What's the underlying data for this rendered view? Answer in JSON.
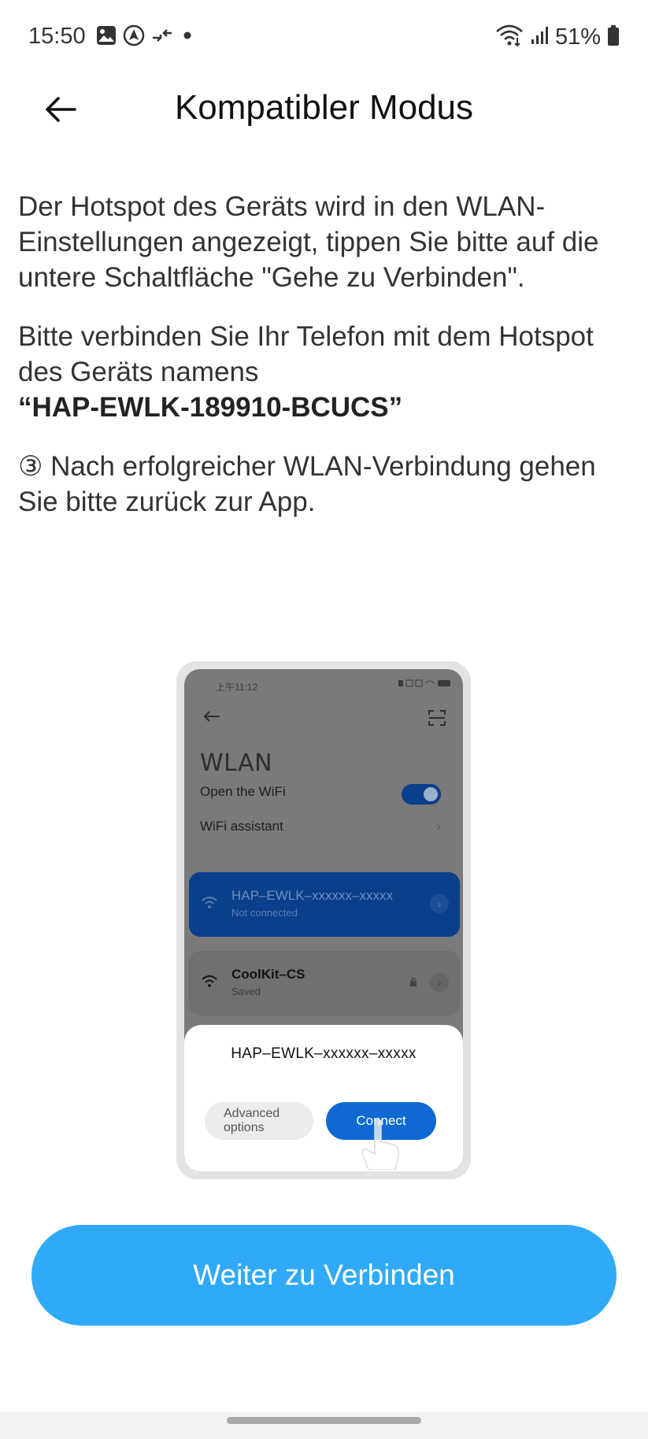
{
  "status_bar": {
    "time": "15:50",
    "battery": "51%",
    "icons": [
      "image-icon",
      "location-icon",
      "transfer-icon",
      "dot-icon",
      "wifi-icon",
      "signal-icon",
      "battery-icon"
    ]
  },
  "header": {
    "title": "Kompatibler Modus",
    "back_icon": "arrow-left-icon"
  },
  "instructions": {
    "paragraph1": "Der Hotspot des Geräts wird in den WLAN-Einstellungen angezeigt, tippen Sie bitte auf die untere Schaltfläche \"Gehe zu Verbinden\".",
    "paragraph2_text": "Bitte verbinden Sie Ihr Telefon mit dem Hotspot des Geräts namens",
    "hotspot_name": "“HAP-EWLK-189910-BCUCS”",
    "paragraph3": "③ Nach erfolgreicher WLAN-Verbindung gehen Sie bitte zurück zur App."
  },
  "illustration": {
    "time": "上午11:12",
    "title": "WLAN",
    "open_wifi_label": "Open the WiFi",
    "wifi_assistant_label": "WiFi assistant",
    "networks": [
      {
        "name": "HAP–EWLK–xxxxxx–xxxxx",
        "status": "Not connected"
      },
      {
        "name": "CoolKit–CS",
        "status": "Saved"
      }
    ],
    "dialog": {
      "title": "HAP–EWLK–xxxxxx–xxxxx",
      "advanced_line1": "Advanced",
      "advanced_line2": "options",
      "connect_label": "Connect"
    }
  },
  "primary_button": {
    "label": "Weiter zu Verbinden"
  },
  "colors": {
    "accent": "#30aaf8",
    "illustration_active": "#0a3f8c",
    "illustration_connect": "#0e6ad2"
  }
}
